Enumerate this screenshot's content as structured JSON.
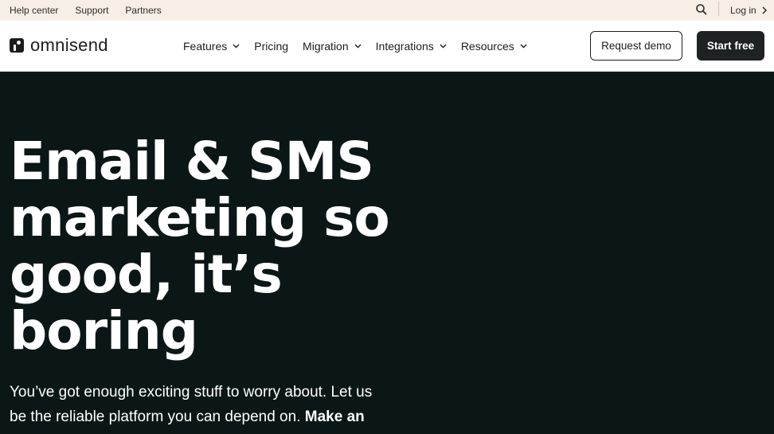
{
  "topbar": {
    "links": [
      "Help center",
      "Support",
      "Partners"
    ],
    "search_icon": "search-icon",
    "login": "Log in"
  },
  "navbar": {
    "logo_text": "omnisend",
    "menu": [
      {
        "label": "Features",
        "has_dropdown": true
      },
      {
        "label": "Pricing",
        "has_dropdown": false
      },
      {
        "label": "Migration",
        "has_dropdown": true
      },
      {
        "label": "Integrations",
        "has_dropdown": true
      },
      {
        "label": "Resources",
        "has_dropdown": true
      }
    ],
    "request_demo": "Request demo",
    "start_free": "Start free"
  },
  "hero": {
    "heading_lines": [
      "Email & SMS",
      "marketing so",
      "good, it’s",
      "boring"
    ],
    "subtext": "You’ve got enough exciting stuff to worry about. Let us be the reliable platform you can depend on.",
    "subtext_link": "Make an"
  },
  "colors": {
    "topbar_bg": "#f7efe5",
    "hero_bg": "#0b1716",
    "button_dark": "#1e2222"
  }
}
